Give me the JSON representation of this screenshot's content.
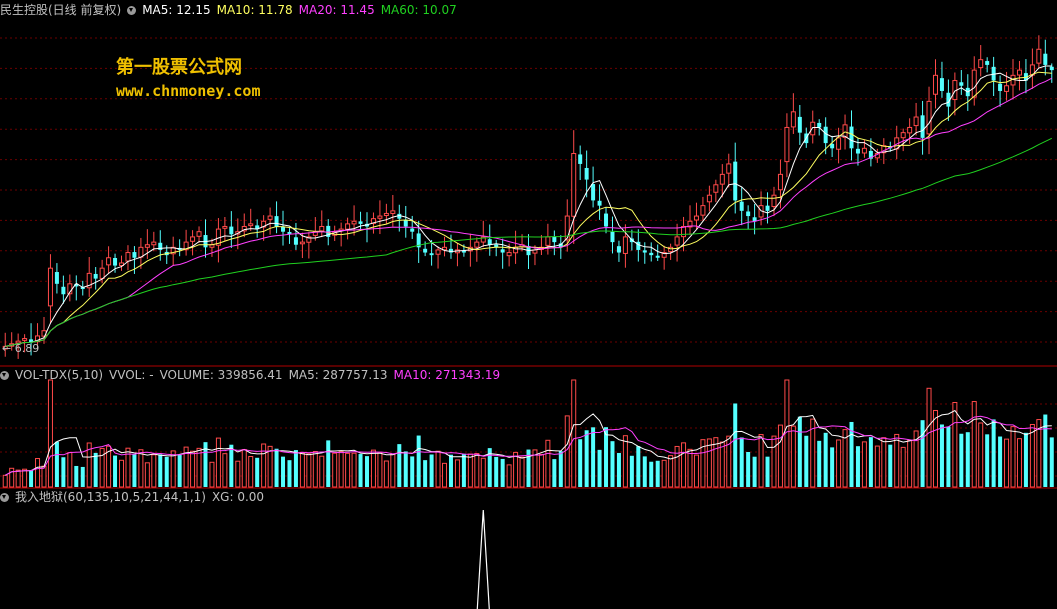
{
  "colors": {
    "up": "#ff4a4a",
    "down": "#54ffff",
    "ma5": "#ffffff",
    "ma10": "#ffff60",
    "ma20": "#ff40ff",
    "ma60": "#20d020",
    "grid": "#6b0000",
    "sep": "#b00000",
    "label": "#c0c0c0",
    "xg": "#ffffff"
  },
  "header": {
    "title": "民生控股(日线 前复权)",
    "ma5": "MA5: 12.15",
    "ma10": "MA10: 11.78",
    "ma20": "MA20: 11.45",
    "ma60": "MA60: 10.07"
  },
  "watermark": {
    "line1": "第一股票公式网",
    "line2": "www.chnmoney.com"
  },
  "price_low_label": "6.89",
  "volume_header": {
    "indicator": "VOL-TDX(5,10)",
    "vvol": "VVOL: -",
    "volume": "VOLUME: 339856.41",
    "ma5": "MA5: 287757.13",
    "ma10": "MA10: 271343.19"
  },
  "signal_header": {
    "indicator": "我入地狱(60,135,10,5,21,44,1,1)",
    "xg": "XG: 0.00"
  },
  "chart_data": {
    "type": "candlestick",
    "price_ylim": [
      6.8,
      13.4
    ],
    "closes": [
      7.1,
      7.15,
      7.2,
      7.25,
      7.18,
      7.3,
      7.4,
      8.6,
      8.3,
      8.1,
      8.3,
      8.25,
      8.2,
      8.5,
      8.4,
      8.6,
      8.8,
      8.65,
      8.7,
      8.9,
      8.8,
      9.0,
      9.05,
      9.1,
      8.95,
      8.85,
      9.0,
      8.95,
      9.1,
      9.2,
      9.3,
      9.0,
      9.05,
      9.35,
      9.4,
      9.25,
      9.3,
      9.4,
      9.45,
      9.35,
      9.5,
      9.6,
      9.4,
      9.3,
      9.25,
      9.05,
      9.1,
      9.2,
      9.3,
      9.4,
      9.2,
      9.3,
      9.35,
      9.45,
      9.5,
      9.45,
      9.4,
      9.55,
      9.6,
      9.65,
      9.7,
      9.55,
      9.4,
      9.3,
      9.0,
      8.9,
      8.85,
      8.95,
      9.0,
      8.9,
      8.95,
      8.9,
      9.0,
      9.1,
      9.2,
      9.05,
      9.0,
      8.9,
      8.9,
      9.0,
      9.05,
      8.85,
      8.95,
      9.0,
      9.2,
      9.1,
      9.0,
      9.6,
      10.8,
      10.6,
      10.3,
      9.9,
      9.8,
      9.4,
      9.1,
      8.9,
      9.2,
      9.1,
      8.95,
      8.9,
      8.85,
      8.8,
      8.9,
      9.0,
      9.2,
      9.4,
      9.5,
      9.6,
      9.8,
      10.0,
      10.2,
      10.4,
      10.6,
      9.9,
      9.7,
      9.6,
      9.5,
      9.8,
      9.7,
      10.0,
      10.4,
      11.3,
      11.6,
      11.2,
      11.0,
      11.4,
      11.3,
      11.0,
      10.9,
      11.1,
      11.35,
      10.9,
      10.8,
      10.9,
      10.7,
      10.8,
      10.95,
      10.9,
      11.1,
      11.2,
      11.3,
      11.5,
      11.1,
      11.8,
      12.3,
      12.0,
      11.7,
      12.2,
      12.1,
      11.9,
      12.4,
      12.6,
      12.5,
      12.2,
      12.0,
      12.1,
      12.3,
      12.4,
      12.2,
      12.5,
      12.8,
      12.5,
      12.4
    ],
    "volume_ylim": [
      0,
      560000
    ],
    "signal": {
      "spike_bar": 74,
      "ylim": [
        0,
        1
      ]
    }
  }
}
